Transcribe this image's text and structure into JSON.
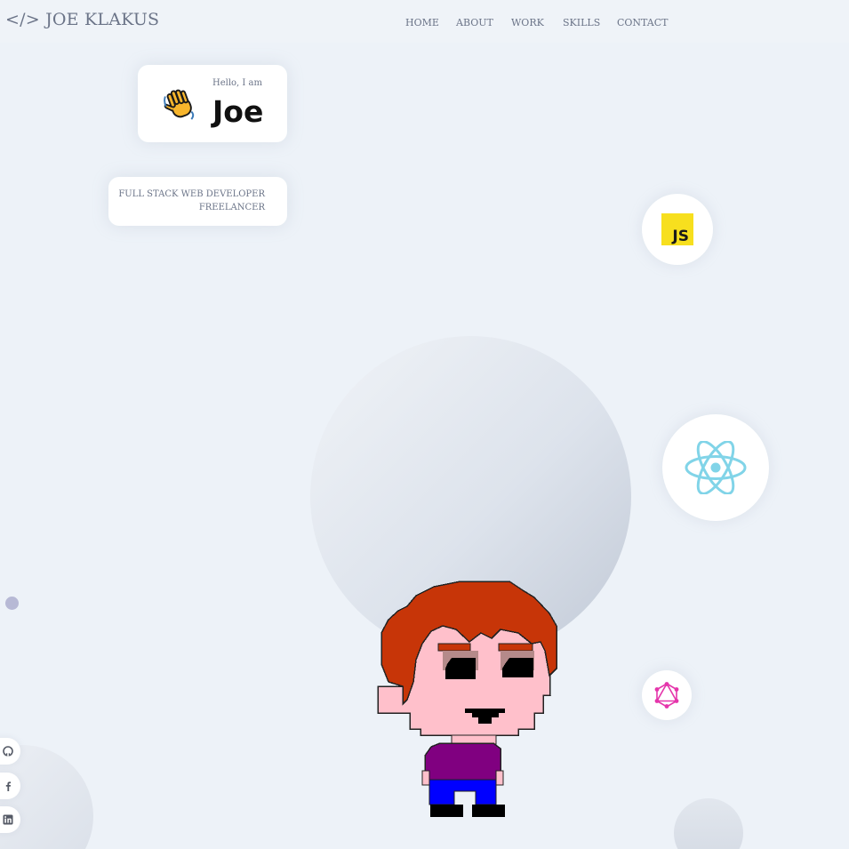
{
  "header": {
    "logo": "</> JOE KLAKUS",
    "nav": [
      {
        "label": "HOME"
      },
      {
        "label": "ABOUT"
      },
      {
        "label": "WORK"
      },
      {
        "label": "SKILLS"
      },
      {
        "label": "CONTACT"
      }
    ]
  },
  "intro": {
    "greeting": "Hello, I am",
    "name": "Joe",
    "wave_icon": "waving-hand-icon",
    "roles": [
      "FULL STACK WEB DEVELOPER",
      "FREELANCER"
    ]
  },
  "skills": [
    {
      "name": "javascript",
      "icon": "javascript-icon",
      "label": "JS",
      "color": "#f7df1e"
    },
    {
      "name": "react",
      "icon": "react-icon",
      "color": "#61dafb"
    },
    {
      "name": "graphql",
      "icon": "graphql-icon",
      "color": "#e535ab"
    }
  ],
  "social": [
    {
      "name": "github",
      "icon": "github-icon"
    },
    {
      "name": "facebook",
      "icon": "facebook-icon"
    },
    {
      "name": "linkedin",
      "icon": "linkedin-icon"
    }
  ],
  "colors": {
    "background": "#edf2f8",
    "text_muted": "#6b7488",
    "hair": "#c73508",
    "skin": "#ffc0cb",
    "shirt": "#800080",
    "pants": "#0000ff"
  }
}
